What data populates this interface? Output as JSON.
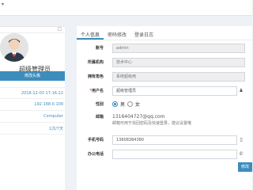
{
  "topbar": {
    "caret_icon": "caret-down-icon"
  },
  "profile": {
    "username": "超级管理员",
    "edit_avatar_label": "修改头像",
    "stats": [
      {
        "value": "2018-12-03 17:16:22"
      },
      {
        "value": "192.168.0.109"
      },
      {
        "value": "Computer"
      },
      {
        "value": "1次/7天"
      }
    ]
  },
  "tabs": [
    {
      "label": "个人信息",
      "active": true
    },
    {
      "label": "密码修改",
      "active": false
    },
    {
      "label": "登录日志",
      "active": false
    }
  ],
  "form": {
    "account": {
      "label": "账号",
      "value": "admin"
    },
    "org": {
      "label": "所属机构",
      "value": "技术中心"
    },
    "role": {
      "label": "拥有角色",
      "value": "系统超级用"
    },
    "name": {
      "label": "用户名",
      "required_mark": "*",
      "value": "超级管理员"
    },
    "gender": {
      "label": "性别",
      "option_male": "男",
      "option_female": "女",
      "selected": "男"
    },
    "email": {
      "label": "邮箱",
      "value": "1316404727@qq.com",
      "hint": "邮箱可用于找回密码及快速登录，建议设置哦"
    },
    "mobile": {
      "label": "手机号码",
      "value": "13608384380"
    },
    "phone": {
      "label": "办公电话",
      "value": ""
    },
    "save_label": "修改"
  }
}
